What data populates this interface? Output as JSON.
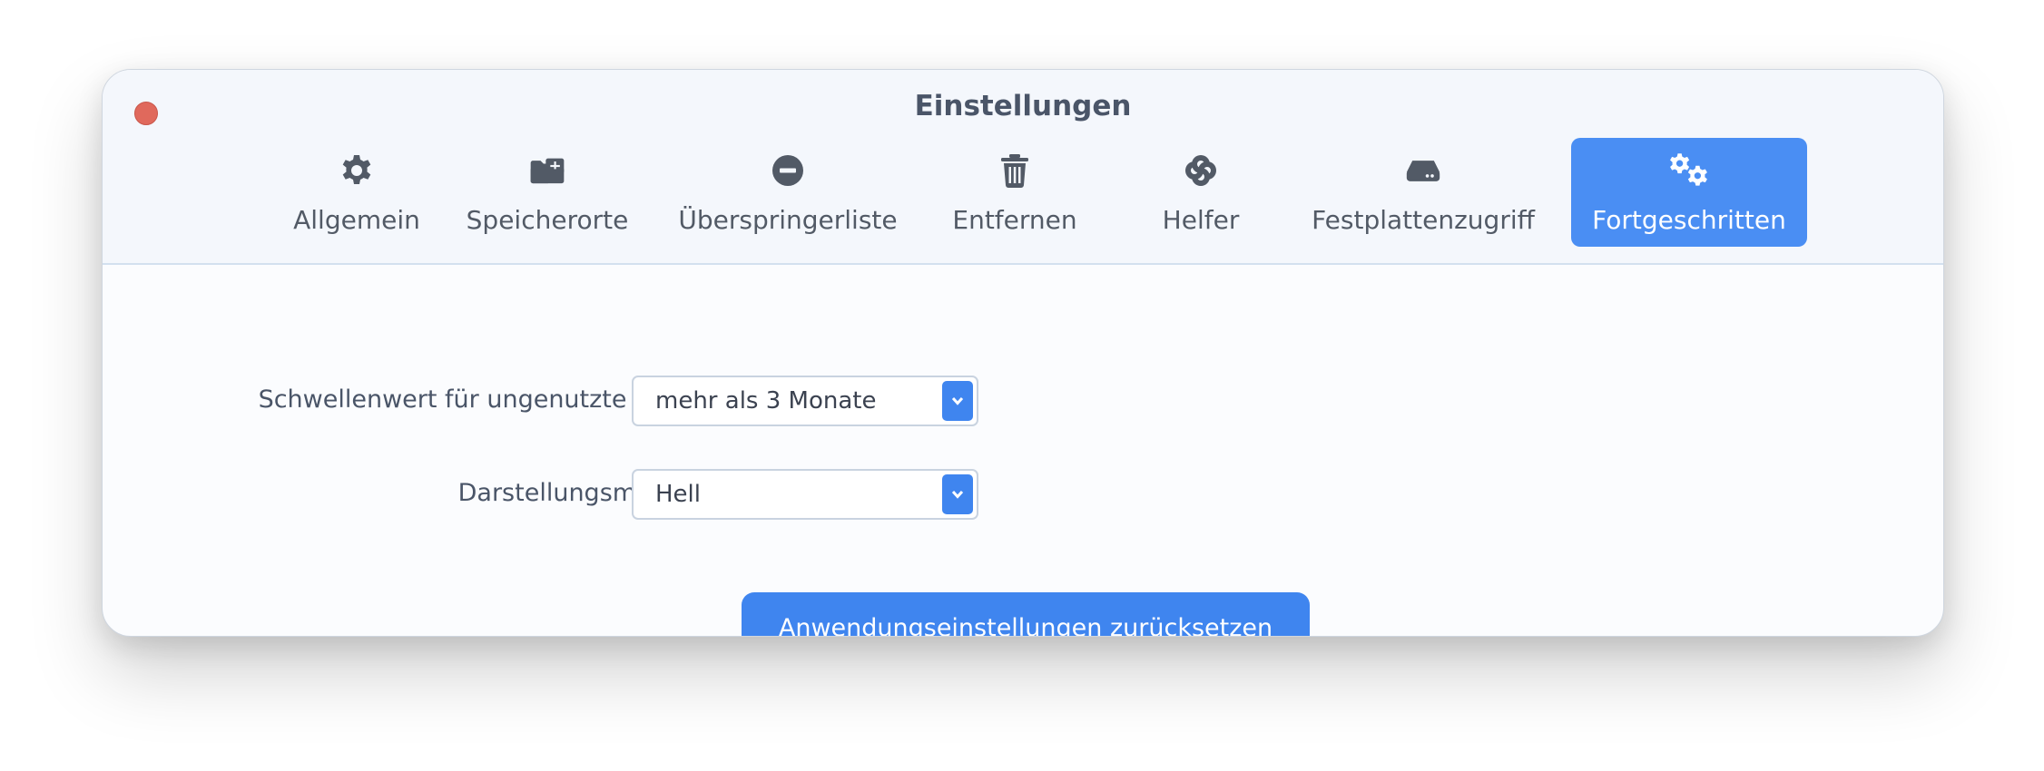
{
  "window": {
    "title": "Einstellungen"
  },
  "tabs": [
    {
      "label": "Allgemein",
      "icon": "gear-icon"
    },
    {
      "label": "Speicherorte",
      "icon": "folder-plus-icon"
    },
    {
      "label": "Überspringerliste",
      "icon": "minus-circle-icon"
    },
    {
      "label": "Entfernen",
      "icon": "trash-icon"
    },
    {
      "label": "Helfer",
      "icon": "helper-icon"
    },
    {
      "label": "Festplattenzugriff",
      "icon": "hard-drive-icon"
    },
    {
      "label": "Fortgeschritten",
      "icon": "gears-icon",
      "active": true
    }
  ],
  "settings": {
    "unused_apps": {
      "label": "Schwellenwert für ungenutzte Apps:",
      "value": "mehr als 3 Monate"
    },
    "appearance": {
      "label": "Darstellungsmodus:",
      "value": "Hell"
    }
  },
  "reset_button": {
    "label": "Anwendungseinstellungen zurücksetzen"
  },
  "colors": {
    "accent": "#4a8ef3",
    "close": "#e0695c",
    "titlebar": "#f4f7fc",
    "text": "#525a66"
  }
}
